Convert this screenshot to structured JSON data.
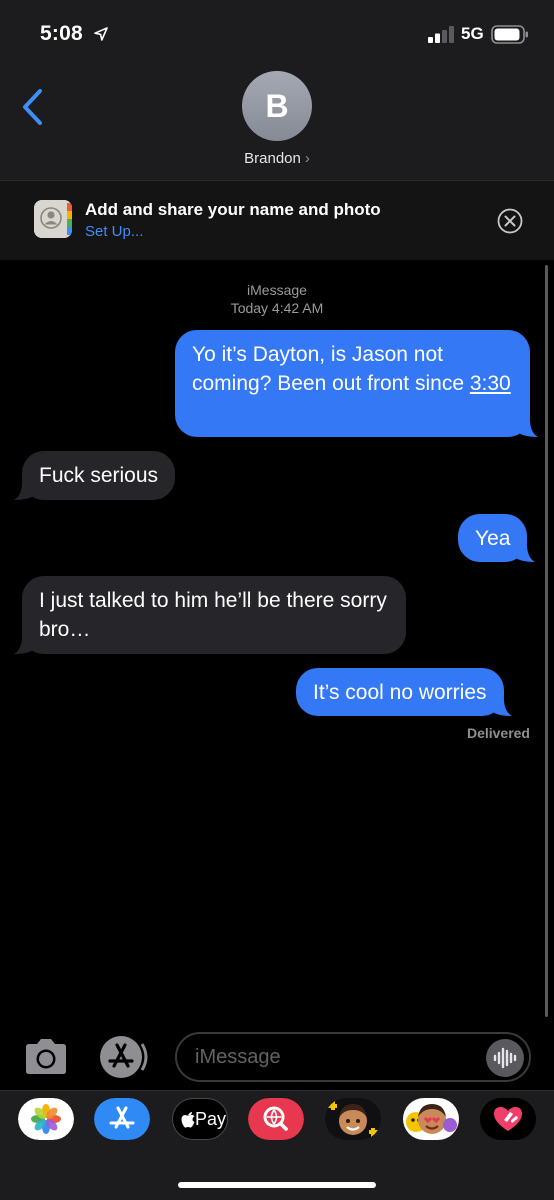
{
  "status_bar": {
    "time": "5:08",
    "network": "5G"
  },
  "header": {
    "avatar_initial": "B",
    "contact_name": "Brandon",
    "chevron": "›"
  },
  "banner": {
    "title": "Add and share your name and photo",
    "link": "Set Up..."
  },
  "conversation": {
    "service": "iMessage",
    "timestamp": "Today 4:42 AM",
    "messages": [
      {
        "from": "me",
        "text_a": "Yo it’s Dayton, is Jason not coming? Been out front since ",
        "text_b": "3:30"
      },
      {
        "from": "them",
        "text": "Fuck serious"
      },
      {
        "from": "me",
        "text": "Yea"
      },
      {
        "from": "them",
        "text": "I just talked to him he’ll be there sorry bro…"
      },
      {
        "from": "me",
        "text": "It’s cool no worries"
      }
    ],
    "delivery_status": "Delivered"
  },
  "compose": {
    "placeholder": "iMessage"
  },
  "app_drawer": {
    "apple_pay_label": "Pay",
    "apps": [
      "photos-icon",
      "app-store-icon",
      "apple-pay-icon",
      "search-images-icon",
      "memoji-icon",
      "memoji-stickers-icon",
      "digital-touch-icon"
    ]
  },
  "colors": {
    "sent_bubble": "#3478f6",
    "received_bubble": "#26252a",
    "link": "#3e8ef7",
    "header_bg": "#1c1c1e"
  }
}
